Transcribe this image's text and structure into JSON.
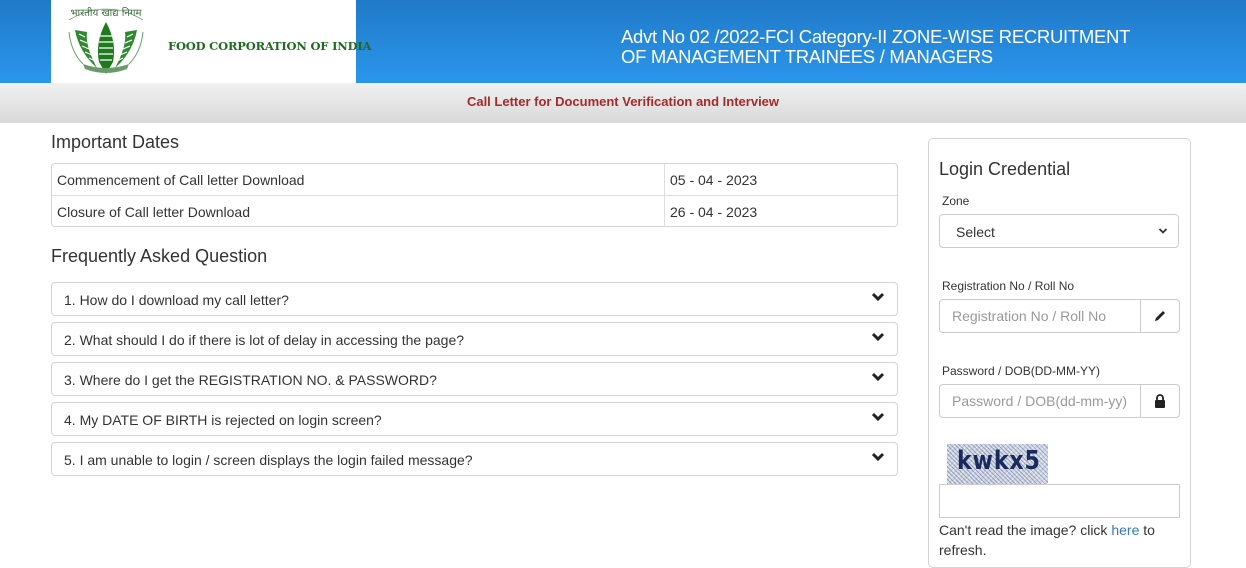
{
  "header": {
    "logo_hindi": "भारतीय खाद्य निगम",
    "org_name": "FOOD CORPORATION OF INDIA",
    "title_line1": "Advt No 02 /2022-FCI Category-II ZONE-WISE RECRUITMENT",
    "title_line2": "OF MANAGEMENT TRAINEES / MANAGERS",
    "gradient_top": "#2079c8",
    "gradient_bottom": "#2b96ec"
  },
  "subheader": {
    "text": "Call Letter for Document Verification and Interview",
    "color": "#a52a2a"
  },
  "important_dates": {
    "title": "Important Dates",
    "rows": [
      {
        "label": "Commencement of Call letter Download",
        "value": "05 - 04 - 2023"
      },
      {
        "label": "Closure of Call letter Download",
        "value": "26 - 04 - 2023"
      }
    ]
  },
  "faq": {
    "title": "Frequently Asked Question",
    "items": [
      {
        "question": "1. How do I download my call letter?"
      },
      {
        "question": "2. What should I do if there is lot of delay in accessing the page?"
      },
      {
        "question": "3. Where do I get the REGISTRATION NO. & PASSWORD?"
      },
      {
        "question": "4. My DATE OF BIRTH is rejected on login screen?"
      },
      {
        "question": "5. I am unable to login / screen displays the login failed message?"
      }
    ],
    "expand_icon": "chevron-down-icon"
  },
  "login": {
    "title": "Login Credential",
    "zone_label": "Zone",
    "zone_selected": "Select",
    "registration_label": "Registration No / Roll No",
    "registration_placeholder": "Registration No / Roll No",
    "registration_value": "",
    "registration_icon": "pencil-icon",
    "password_label": "Password / DOB(DD-MM-YY)",
    "password_placeholder": "Password / DOB(dd-mm-yy)",
    "password_value": "",
    "password_icon": "lock-icon",
    "captcha_text": "kwkx5",
    "captcha_value": "",
    "refresh_prefix": "Can't read the image? click ",
    "refresh_link": "here",
    "refresh_suffix": " to refresh.",
    "link_color": "#337ab7"
  }
}
